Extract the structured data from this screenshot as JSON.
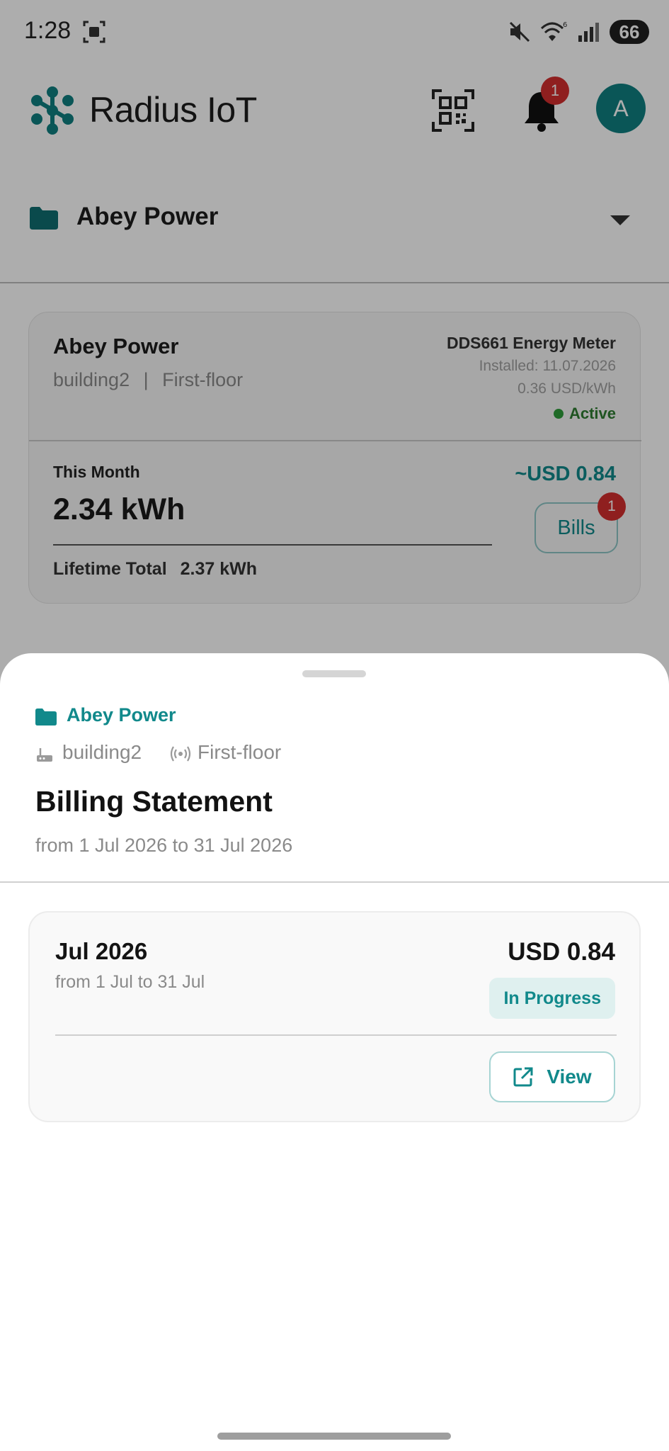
{
  "status_bar": {
    "time": "1:28",
    "battery": "66",
    "icons": [
      "screenshot-icon",
      "mute-icon",
      "wifi-6-icon",
      "cell-signal-icon"
    ]
  },
  "header": {
    "app_name": "Radius IoT",
    "notification_count": "1",
    "avatar_initial": "A",
    "brand_color": "#11898b"
  },
  "project_selector": {
    "name": "Abey Power"
  },
  "meter_card": {
    "title": "Abey Power",
    "building": "building2",
    "separator": "|",
    "floor": "First-floor",
    "meter_name": "DDS661 Energy Meter",
    "installed": "Installed: 11.07.2026",
    "rate": "0.36 USD/kWh",
    "status": "Active",
    "this_month_label": "This Month",
    "this_month_value": "2.34 kWh",
    "estimated_cost": "~USD 0.84",
    "bills_label": "Bills",
    "bills_count": "1",
    "lifetime_label": "Lifetime Total",
    "lifetime_value": "2.37 kWh"
  },
  "sheet": {
    "project": "Abey Power",
    "building": "building2",
    "floor": "First-floor",
    "title": "Billing Statement",
    "range": "from 1 Jul 2026 to 31 Jul 2026",
    "bill": {
      "month": "Jul 2026",
      "range": "from 1 Jul to 31 Jul",
      "amount": "USD 0.84",
      "status": "In Progress",
      "view_label": "View"
    }
  }
}
